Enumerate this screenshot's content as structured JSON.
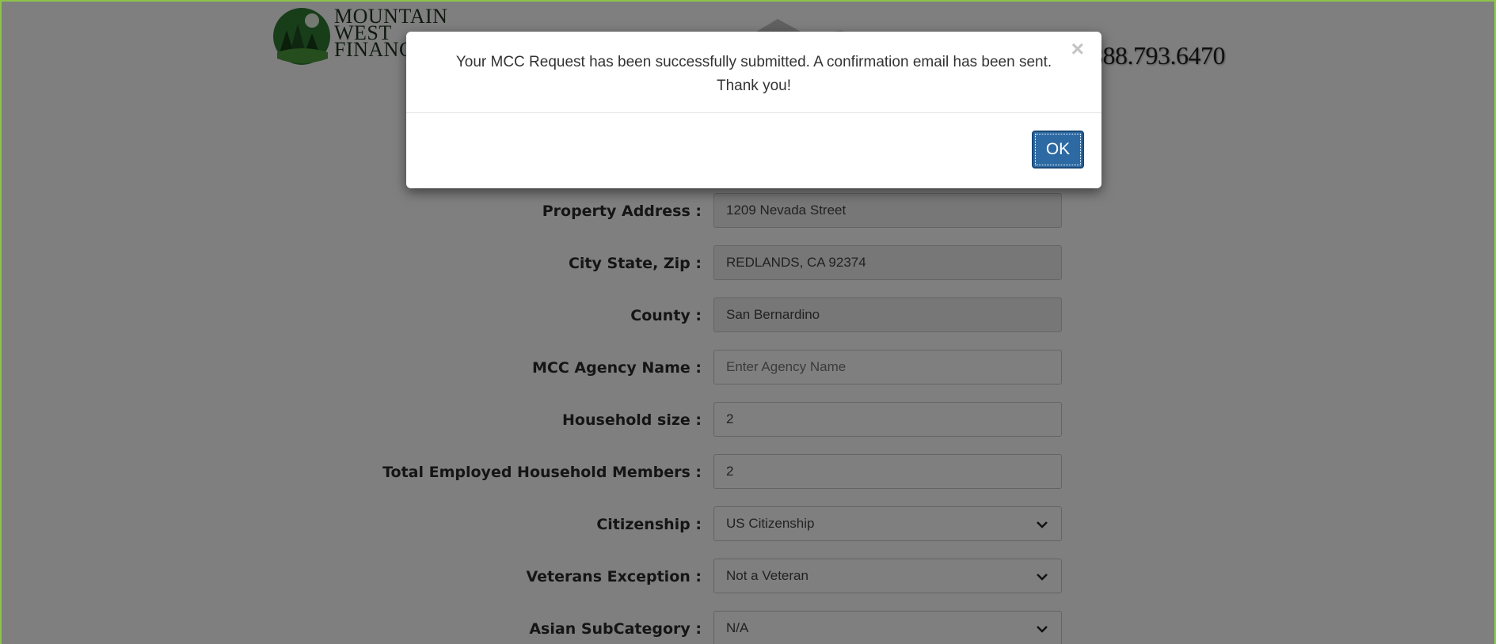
{
  "header": {
    "logo_lines": [
      "MOUNTAIN",
      "WEST",
      "FINANCIAL"
    ],
    "phone": "888.793.6470"
  },
  "form": {
    "fields": [
      {
        "label": "Property Address :",
        "value": "1209 Nevada Street",
        "type": "text",
        "readonly": true
      },
      {
        "label": "City State, Zip :",
        "value": "REDLANDS, CA 92374",
        "type": "text",
        "readonly": true
      },
      {
        "label": "County :",
        "value": "San Bernardino",
        "type": "text",
        "readonly": true
      },
      {
        "label": "MCC Agency Name :",
        "value": "",
        "placeholder": "Enter Agency Name",
        "type": "text",
        "readonly": false
      },
      {
        "label": "Household size :",
        "value": "2",
        "type": "text",
        "readonly": false
      },
      {
        "label": "Total Employed Household Members :",
        "value": "2",
        "type": "text",
        "readonly": false
      },
      {
        "label": "Citizenship :",
        "value": "US Citizenship",
        "type": "select",
        "icon": "chevron-down-icon"
      },
      {
        "label": "Veterans Exception :",
        "value": "Not a Veteran",
        "type": "select",
        "icon": "chevron-down-icon"
      },
      {
        "label": "Asian SubCategory :",
        "value": "N/A",
        "type": "select",
        "icon": "chevron-down-icon"
      }
    ]
  },
  "modal": {
    "message": "Your MCC Request has been successfully submitted. A confirmation email has been sent. Thank you!",
    "close_label": "×",
    "ok_label": "OK"
  },
  "colors": {
    "frame_border": "#8bc34a",
    "ok_button": "#2d6aa3",
    "overlay": "rgba(0,0,0,0.5)"
  }
}
